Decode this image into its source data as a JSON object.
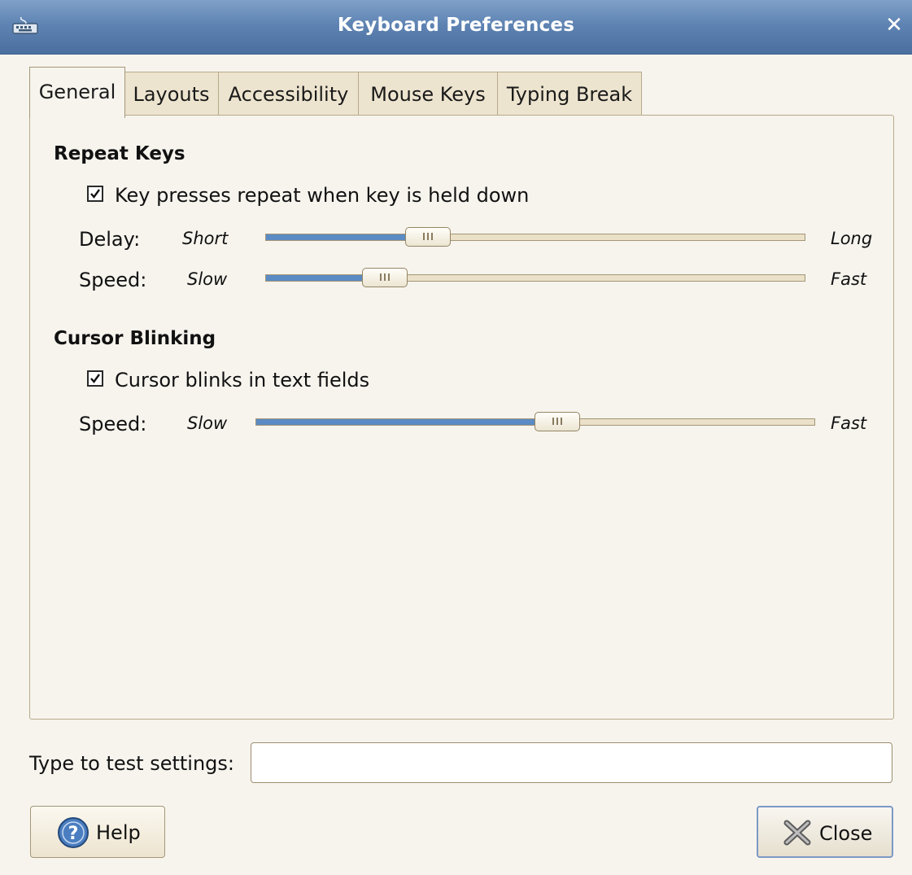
{
  "window": {
    "title": "Keyboard Preferences",
    "close_icon": "close-icon",
    "app_icon": "keyboard-icon"
  },
  "tabs": [
    {
      "label": "General",
      "active": true
    },
    {
      "label": "Layouts",
      "active": false
    },
    {
      "label": "Accessibility",
      "active": false
    },
    {
      "label": "Mouse Keys",
      "active": false
    },
    {
      "label": "Typing Break",
      "active": false
    }
  ],
  "repeat_keys": {
    "heading": "Repeat Keys",
    "checkbox": {
      "label": "Key presses repeat when key is held down",
      "checked": true
    },
    "delay": {
      "label": "Delay:",
      "min_label": "Short",
      "max_label": "Long",
      "value_fraction": 0.3
    },
    "speed": {
      "label": "Speed:",
      "min_label": "Slow",
      "max_label": "Fast",
      "value_fraction": 0.22
    }
  },
  "cursor_blinking": {
    "heading": "Cursor Blinking",
    "checkbox": {
      "label": "Cursor blinks in text fields",
      "checked": true
    },
    "speed": {
      "label": "Speed:",
      "min_label": "Slow",
      "max_label": "Fast",
      "value_fraction": 0.54
    }
  },
  "test_field": {
    "label": "Type to test settings:",
    "value": ""
  },
  "buttons": {
    "help_label": "Help",
    "help_icon": "help-icon",
    "close_label": "Close",
    "close_icon": "close-x-icon"
  },
  "colors": {
    "titlebar": "#5f84b3",
    "slider_fill": "#5b8bc4",
    "background": "#f7f4ee"
  }
}
